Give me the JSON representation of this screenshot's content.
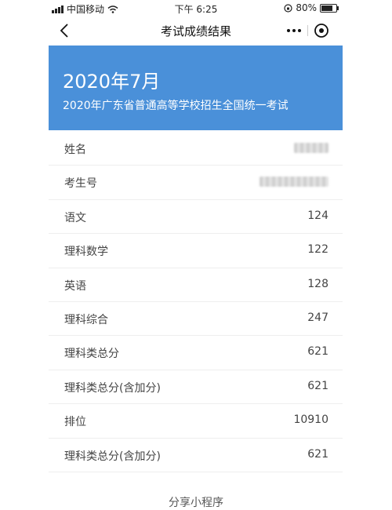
{
  "status_bar": {
    "carrier": "中国移动",
    "time": "下午 6:25",
    "battery": "80%",
    "battery_level": 0.8
  },
  "nav": {
    "title": "考试成绩结果"
  },
  "banner": {
    "date": "2020年7月",
    "subtitle": "2020年广东省普通高等学校招生全国统一考试"
  },
  "rows": [
    {
      "label": "姓名",
      "value": ""
    },
    {
      "label": "考生号",
      "value": ""
    },
    {
      "label": "语文",
      "value": "124"
    },
    {
      "label": "理科数学",
      "value": "122"
    },
    {
      "label": "英语",
      "value": "128"
    },
    {
      "label": "理科综合",
      "value": "247"
    },
    {
      "label": "理科类总分",
      "value": "621"
    },
    {
      "label": "理科类总分(含加分)",
      "value": "621"
    },
    {
      "label": "排位",
      "value": "10910"
    },
    {
      "label": "理科类总分(含加分)",
      "value": "621"
    }
  ],
  "footer": {
    "text": "分享小程序"
  }
}
